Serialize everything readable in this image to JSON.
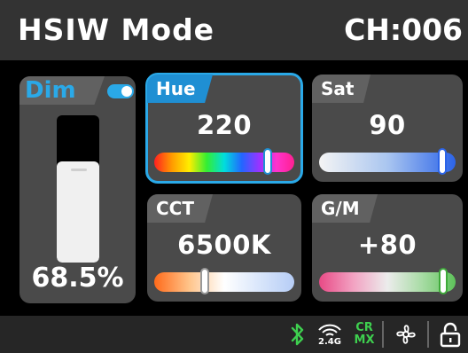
{
  "header": {
    "title": "HSIW Mode",
    "channel": "CH:006"
  },
  "dim": {
    "label": "Dim",
    "toggle_on": true,
    "level": 0.685,
    "value_text": "68.5%",
    "accent": "#2aa9e8"
  },
  "cards": {
    "hue": {
      "label": "Hue",
      "value": "220",
      "slider": 0.81,
      "selected": true
    },
    "sat": {
      "label": "Sat",
      "value": "90",
      "slider": 0.9
    },
    "cct": {
      "label": "CCT",
      "value": "6500K",
      "slider": 0.36
    },
    "gm": {
      "label": "G/M",
      "value": "+80",
      "slider": 0.91
    }
  },
  "status": {
    "wifi_band": "2.4G",
    "cr_top": "CR",
    "cr_bottom": "MX"
  },
  "colors": {
    "header_bg": "#333333",
    "card_bg": "#4a4a4a",
    "tab_bg": "#616161",
    "accent": "#2aa9e8",
    "status_green": "#3ecf4f"
  }
}
